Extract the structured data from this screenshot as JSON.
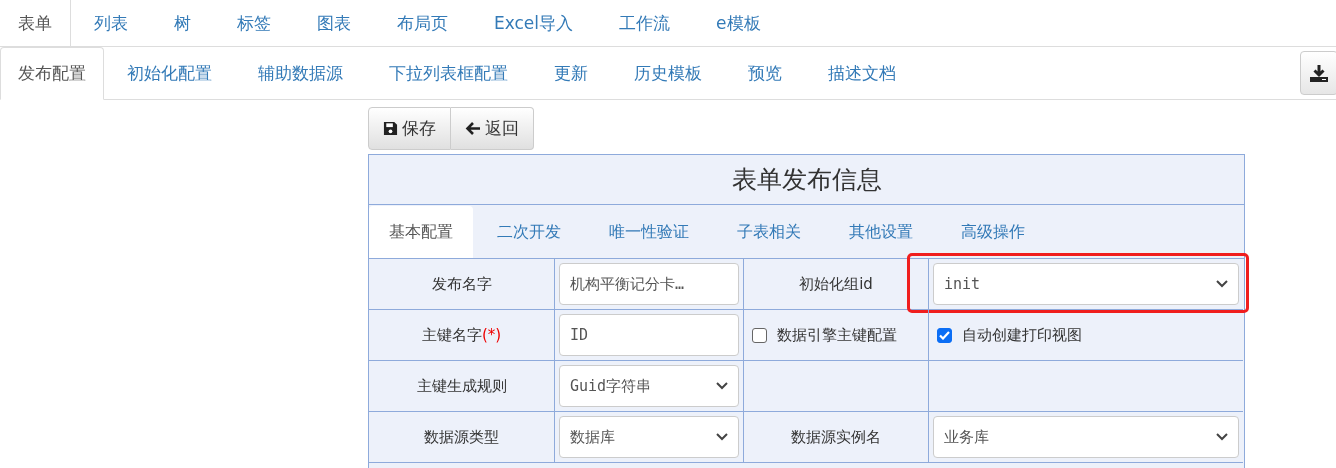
{
  "top_tabs": [
    {
      "label": "表单",
      "selected": true
    },
    {
      "label": "列表",
      "selected": false
    },
    {
      "label": "树",
      "selected": false
    },
    {
      "label": "标签",
      "selected": false
    },
    {
      "label": "图表",
      "selected": false
    },
    {
      "label": "布局页",
      "selected": false
    },
    {
      "label": "Excel导入",
      "selected": false
    },
    {
      "label": "工作流",
      "selected": false
    },
    {
      "label": "e模板",
      "selected": false
    }
  ],
  "sub_tabs": [
    {
      "label": "发布配置",
      "selected": true
    },
    {
      "label": "初始化配置",
      "selected": false
    },
    {
      "label": "辅助数据源",
      "selected": false
    },
    {
      "label": "下拉列表框配置",
      "selected": false
    },
    {
      "label": "更新",
      "selected": false
    },
    {
      "label": "历史模板",
      "selected": false
    },
    {
      "label": "预览",
      "selected": false
    },
    {
      "label": "描述文档",
      "selected": false
    }
  ],
  "toolbar": [
    {
      "label": "保存"
    },
    {
      "label": "返回"
    }
  ],
  "panel": {
    "title": "表单发布信息",
    "tabs": [
      {
        "label": "基本配置",
        "selected": true
      },
      {
        "label": "二次开发",
        "selected": false
      },
      {
        "label": "唯一性验证",
        "selected": false
      },
      {
        "label": "子表相关",
        "selected": false
      },
      {
        "label": "其他设置",
        "selected": false
      },
      {
        "label": "高级操作",
        "selected": false
      }
    ],
    "rows": [
      [
        {
          "kind": "label",
          "text": "发布名字"
        },
        {
          "kind": "input",
          "value": "机构平衡记分卡…"
        },
        {
          "kind": "label",
          "text": "初始化组id"
        },
        {
          "kind": "select",
          "value": "init",
          "highlighted": true
        }
      ],
      [
        {
          "kind": "label",
          "text": "主键名字",
          "mark": "(*)"
        },
        {
          "kind": "input",
          "value": "ID"
        },
        {
          "kind": "checkbox",
          "label": "数据引擎主键配置",
          "checked": false
        },
        {
          "kind": "checkbox",
          "label": "自动创建打印视图",
          "checked": true
        }
      ],
      [
        {
          "kind": "label",
          "text": "主键生成规则"
        },
        {
          "kind": "select",
          "value": "Guid字符串",
          "highlighted": false
        },
        {
          "kind": "empty"
        },
        {
          "kind": "empty"
        }
      ],
      [
        {
          "kind": "label",
          "text": "数据源类型"
        },
        {
          "kind": "select",
          "value": "数据库",
          "highlighted": false
        },
        {
          "kind": "label",
          "text": "数据源实例名"
        },
        {
          "kind": "select",
          "value": "业务库",
          "highlighted": false
        }
      ]
    ]
  }
}
